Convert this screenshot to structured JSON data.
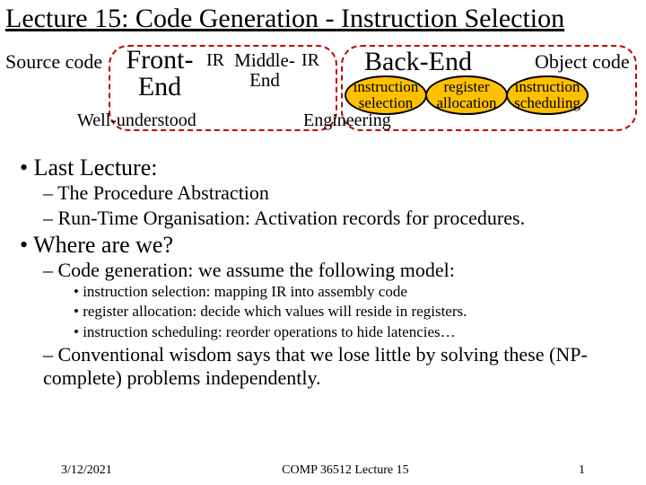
{
  "title": "Lecture 15: Code Generation - Instruction Selection",
  "diagram": {
    "source": "Source code",
    "frontend": "Front-End",
    "ir1": "IR",
    "middle": "Middle-End",
    "ir2": "IR",
    "backend": "Back-End",
    "object": "Object code",
    "oval1a": "instruction",
    "oval1b": "selection",
    "oval2a": "register",
    "oval2b": "allocation",
    "oval3a": "instruction",
    "oval3b": "scheduling",
    "well": "Well-understood",
    "eng": "Engineering"
  },
  "b": {
    "last": "Last Lecture:",
    "last1": "The Procedure Abstraction",
    "last2": "Run-Time Organisation: Activation records for procedures.",
    "where": "Where are we?",
    "where1": "Code generation: we assume the following model:",
    "w1a": "instruction selection: mapping IR into assembly code",
    "w1b": "register allocation: decide which values will reside in registers.",
    "w1c": "instruction scheduling: reorder operations to hide latencies…",
    "where2": "Conventional wisdom says that we lose little by solving these (NP-complete) problems independently."
  },
  "footer": {
    "date": "3/12/2021",
    "course": "COMP 36512 Lecture 15",
    "page": "1"
  }
}
